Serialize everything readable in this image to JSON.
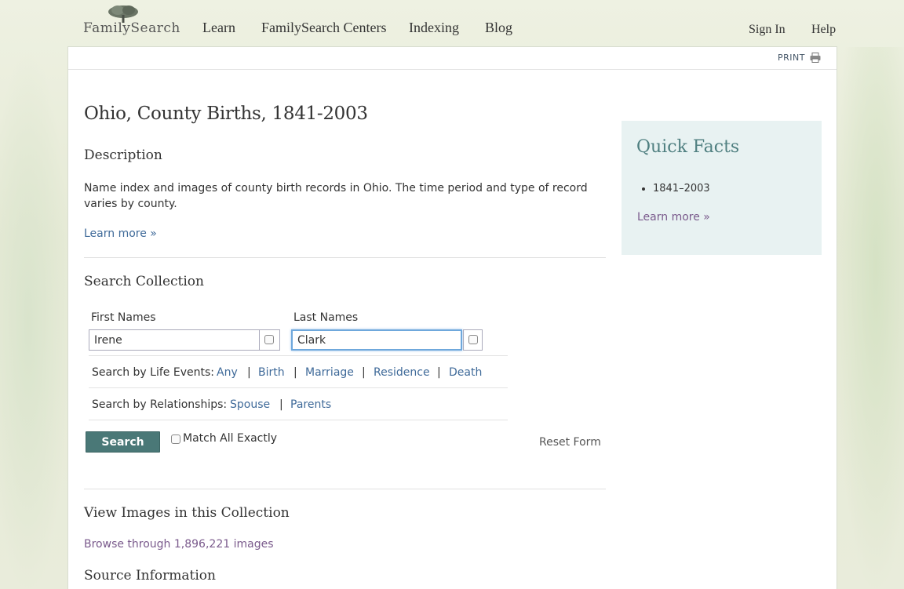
{
  "header": {
    "logo_text": "FamilySearch",
    "nav": [
      "Learn",
      "FamilySearch Centers",
      "Indexing",
      "Blog"
    ],
    "utility": [
      "Sign In",
      "Help"
    ]
  },
  "toolbar": {
    "print_label": "PRINT"
  },
  "page": {
    "title": "Ohio, County Births, 1841-2003",
    "description_heading": "Description",
    "description": "Name index and images of county birth records in Ohio. The time period and type of record varies by county.",
    "learn_more": "Learn more »"
  },
  "search": {
    "heading": "Search Collection",
    "first_label": "First Names",
    "first_value": "Irene",
    "last_label": "Last Names",
    "last_value": "Clark",
    "life_events_label": "Search by Life Events:",
    "life_events": [
      "Any",
      "Birth",
      "Marriage",
      "Residence",
      "Death"
    ],
    "relationships_label": "Search by Relationships:",
    "relationships": [
      "Spouse",
      "Parents"
    ],
    "button": "Search",
    "match_all": "Match All Exactly",
    "reset": "Reset Form"
  },
  "images": {
    "heading": "View Images in this Collection",
    "browse": "Browse through 1,896,221 images"
  },
  "source": {
    "heading": "Source Information"
  },
  "quick_facts": {
    "title": "Quick Facts",
    "items": [
      "1841–2003"
    ],
    "learn_more": "Learn more »"
  },
  "colors": {
    "button_bg": "#4a7877",
    "link": "#3f6a99",
    "visited_link": "#7a5a8c",
    "quick_facts_bg": "#e8f2f2"
  }
}
